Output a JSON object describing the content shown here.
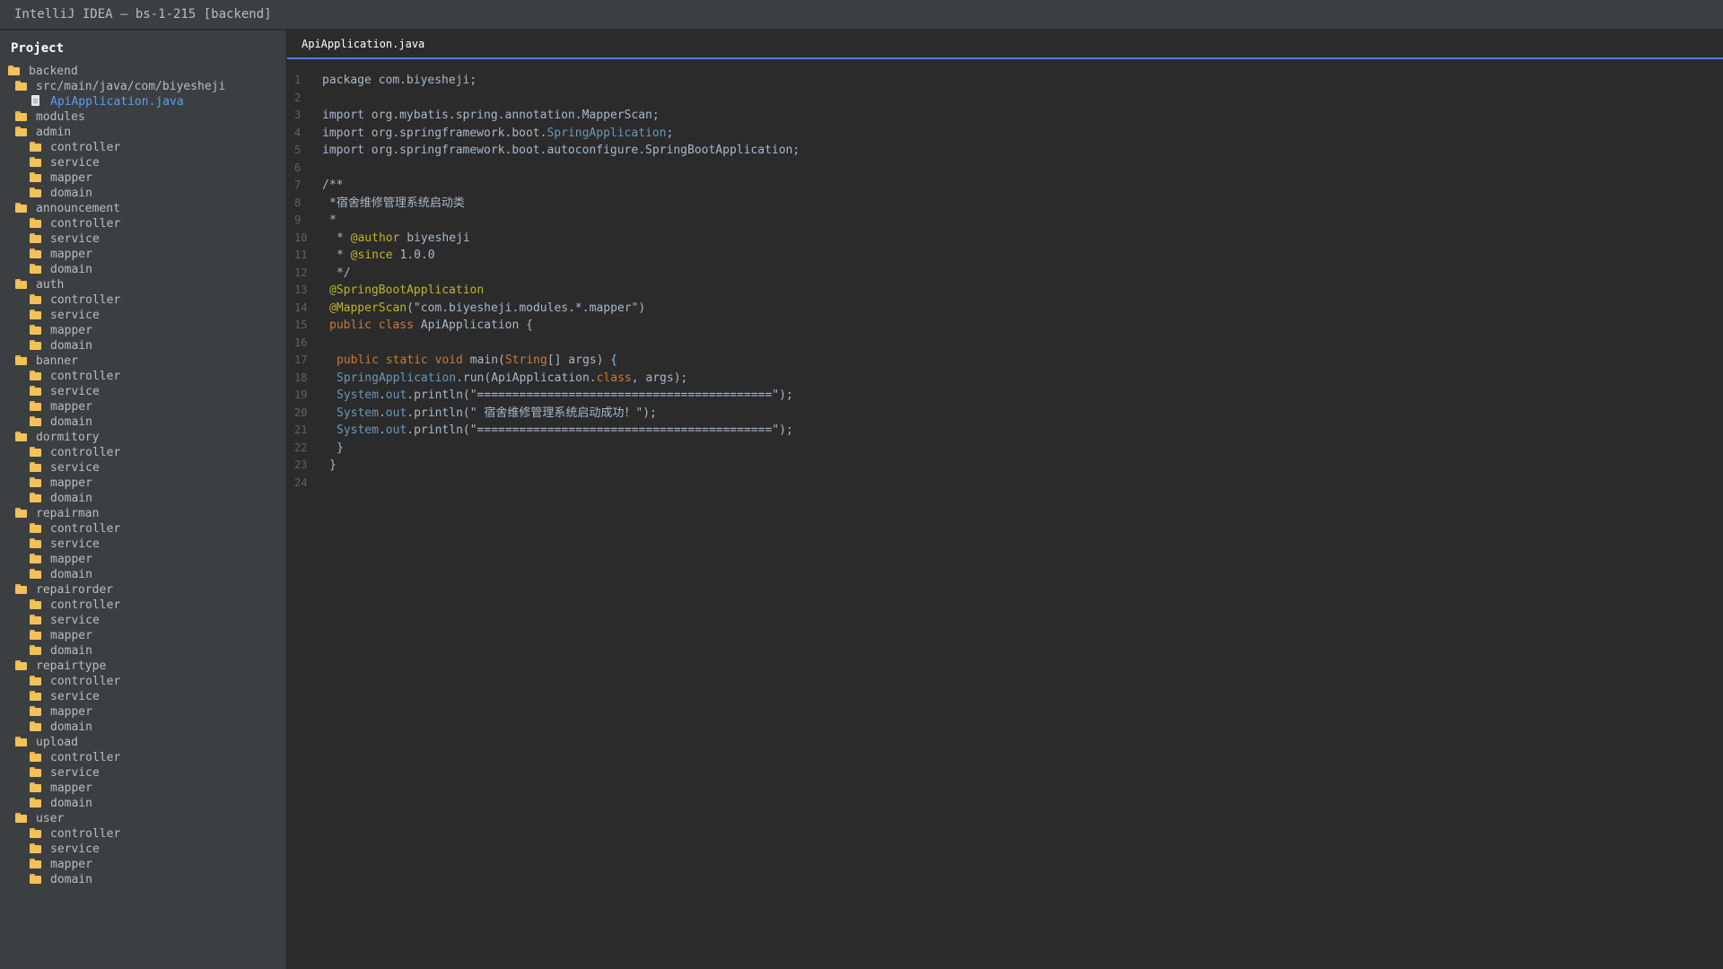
{
  "window": {
    "title": "IntelliJ IDEA — bs-1-215 [backend]"
  },
  "project_panel": {
    "title": "Project",
    "tree": [
      {
        "label": "backend",
        "type": "folder",
        "level": 0
      },
      {
        "label": "src/main/java/com/biyesheji",
        "type": "folder",
        "level": 1
      },
      {
        "label": "ApiApplication.java",
        "type": "file",
        "level": 2,
        "selected": true
      },
      {
        "label": "modules",
        "type": "folder",
        "level": 1
      },
      {
        "label": "admin",
        "type": "folder",
        "level": 1
      },
      {
        "label": "controller",
        "type": "folder",
        "level": 2
      },
      {
        "label": "service",
        "type": "folder",
        "level": 2
      },
      {
        "label": "mapper",
        "type": "folder",
        "level": 2
      },
      {
        "label": "domain",
        "type": "folder",
        "level": 2
      },
      {
        "label": "announcement",
        "type": "folder",
        "level": 1
      },
      {
        "label": "controller",
        "type": "folder",
        "level": 2
      },
      {
        "label": "service",
        "type": "folder",
        "level": 2
      },
      {
        "label": "mapper",
        "type": "folder",
        "level": 2
      },
      {
        "label": "domain",
        "type": "folder",
        "level": 2
      },
      {
        "label": "auth",
        "type": "folder",
        "level": 1
      },
      {
        "label": "controller",
        "type": "folder",
        "level": 2
      },
      {
        "label": "service",
        "type": "folder",
        "level": 2
      },
      {
        "label": "mapper",
        "type": "folder",
        "level": 2
      },
      {
        "label": "domain",
        "type": "folder",
        "level": 2
      },
      {
        "label": "banner",
        "type": "folder",
        "level": 1
      },
      {
        "label": "controller",
        "type": "folder",
        "level": 2
      },
      {
        "label": "service",
        "type": "folder",
        "level": 2
      },
      {
        "label": "mapper",
        "type": "folder",
        "level": 2
      },
      {
        "label": "domain",
        "type": "folder",
        "level": 2
      },
      {
        "label": "dormitory",
        "type": "folder",
        "level": 1
      },
      {
        "label": "controller",
        "type": "folder",
        "level": 2
      },
      {
        "label": "service",
        "type": "folder",
        "level": 2
      },
      {
        "label": "mapper",
        "type": "folder",
        "level": 2
      },
      {
        "label": "domain",
        "type": "folder",
        "level": 2
      },
      {
        "label": "repairman",
        "type": "folder",
        "level": 1
      },
      {
        "label": "controller",
        "type": "folder",
        "level": 2
      },
      {
        "label": "service",
        "type": "folder",
        "level": 2
      },
      {
        "label": "mapper",
        "type": "folder",
        "level": 2
      },
      {
        "label": "domain",
        "type": "folder",
        "level": 2
      },
      {
        "label": "repairorder",
        "type": "folder",
        "level": 1
      },
      {
        "label": "controller",
        "type": "folder",
        "level": 2
      },
      {
        "label": "service",
        "type": "folder",
        "level": 2
      },
      {
        "label": "mapper",
        "type": "folder",
        "level": 2
      },
      {
        "label": "domain",
        "type": "folder",
        "level": 2
      },
      {
        "label": "repairtype",
        "type": "folder",
        "level": 1
      },
      {
        "label": "controller",
        "type": "folder",
        "level": 2
      },
      {
        "label": "service",
        "type": "folder",
        "level": 2
      },
      {
        "label": "mapper",
        "type": "folder",
        "level": 2
      },
      {
        "label": "domain",
        "type": "folder",
        "level": 2
      },
      {
        "label": "upload",
        "type": "folder",
        "level": 1
      },
      {
        "label": "controller",
        "type": "folder",
        "level": 2
      },
      {
        "label": "service",
        "type": "folder",
        "level": 2
      },
      {
        "label": "mapper",
        "type": "folder",
        "level": 2
      },
      {
        "label": "domain",
        "type": "folder",
        "level": 2
      },
      {
        "label": "user",
        "type": "folder",
        "level": 1
      },
      {
        "label": "controller",
        "type": "folder",
        "level": 2
      },
      {
        "label": "service",
        "type": "folder",
        "level": 2
      },
      {
        "label": "mapper",
        "type": "folder",
        "level": 2
      },
      {
        "label": "domain",
        "type": "folder",
        "level": 2
      }
    ]
  },
  "editor": {
    "active_tab": "ApiApplication.java",
    "lines": [
      {
        "n": "1",
        "indent": 0,
        "segments": [
          {
            "t": "package com.biyesheji;",
            "c": "plain"
          }
        ]
      },
      {
        "n": "2",
        "indent": 0,
        "segments": []
      },
      {
        "n": "3",
        "indent": 0,
        "segments": [
          {
            "t": "import org.mybatis.spring.annotation.MapperScan;",
            "c": "plain"
          }
        ]
      },
      {
        "n": "4",
        "indent": 0,
        "segments": [
          {
            "t": "import org.springframework.boot.",
            "c": "plain"
          },
          {
            "t": "SpringApplication",
            "c": "cls"
          },
          {
            "t": ";",
            "c": "plain"
          }
        ]
      },
      {
        "n": "5",
        "indent": 0,
        "segments": [
          {
            "t": "import org.springframework.boot.autoconfigure.SpringBootApplication;",
            "c": "plain"
          }
        ]
      },
      {
        "n": "6",
        "indent": 0,
        "segments": []
      },
      {
        "n": "7",
        "indent": 0,
        "segments": [
          {
            "t": "/**",
            "c": "cmt"
          }
        ]
      },
      {
        "n": "8",
        "indent": 1,
        "segments": [
          {
            "t": "*宿舍维修管理系统启动类",
            "c": "cmt"
          }
        ]
      },
      {
        "n": "9",
        "indent": 1,
        "segments": [
          {
            "t": "*",
            "c": "cmt"
          }
        ]
      },
      {
        "n": "10",
        "indent": 2,
        "segments": [
          {
            "t": "* ",
            "c": "cmt"
          },
          {
            "t": "@author",
            "c": "doctag"
          },
          {
            "t": " biyesheji",
            "c": "cmt"
          }
        ]
      },
      {
        "n": "11",
        "indent": 2,
        "segments": [
          {
            "t": "* ",
            "c": "cmt"
          },
          {
            "t": "@since",
            "c": "doctag"
          },
          {
            "t": " 1.0.0",
            "c": "cmt"
          }
        ]
      },
      {
        "n": "12",
        "indent": 2,
        "segments": [
          {
            "t": "*/",
            "c": "cmt"
          }
        ]
      },
      {
        "n": "13",
        "indent": 1,
        "segments": [
          {
            "t": "@SpringBootApplication",
            "c": "ann"
          }
        ]
      },
      {
        "n": "14",
        "indent": 1,
        "segments": [
          {
            "t": "@MapperScan",
            "c": "ann"
          },
          {
            "t": "(\"com.biyesheji.modules.*.mapper\")",
            "c": "plain"
          }
        ]
      },
      {
        "n": "15",
        "indent": 1,
        "segments": [
          {
            "t": "public class",
            "c": "kw"
          },
          {
            "t": " ApiApplication {",
            "c": "plain"
          }
        ]
      },
      {
        "n": "16",
        "indent": 0,
        "segments": []
      },
      {
        "n": "17",
        "indent": 2,
        "segments": [
          {
            "t": "public static void",
            "c": "kw"
          },
          {
            "t": " main(",
            "c": "plain"
          },
          {
            "t": "String",
            "c": "kw"
          },
          {
            "t": "[] args) {",
            "c": "plain"
          }
        ]
      },
      {
        "n": "18",
        "indent": 2,
        "segments": [
          {
            "t": "SpringApplication",
            "c": "cls"
          },
          {
            "t": ".run(ApiApplication.",
            "c": "plain"
          },
          {
            "t": "class",
            "c": "kw"
          },
          {
            "t": ", args);",
            "c": "plain"
          }
        ]
      },
      {
        "n": "19",
        "indent": 2,
        "segments": [
          {
            "t": "System",
            "c": "cls"
          },
          {
            "t": ".",
            "c": "plain"
          },
          {
            "t": "out",
            "c": "cls"
          },
          {
            "t": ".println(\"==========================================\");",
            "c": "plain"
          }
        ]
      },
      {
        "n": "20",
        "indent": 2,
        "segments": [
          {
            "t": "System",
            "c": "cls"
          },
          {
            "t": ".",
            "c": "plain"
          },
          {
            "t": "out",
            "c": "cls"
          },
          {
            "t": ".println(\" 宿舍维修管理系统启动成功！\");",
            "c": "plain"
          }
        ]
      },
      {
        "n": "21",
        "indent": 2,
        "segments": [
          {
            "t": "System",
            "c": "cls"
          },
          {
            "t": ".",
            "c": "plain"
          },
          {
            "t": "out",
            "c": "cls"
          },
          {
            "t": ".println(\"==========================================\");",
            "c": "plain"
          }
        ]
      },
      {
        "n": "22",
        "indent": 2,
        "segments": [
          {
            "t": "}",
            "c": "plain"
          }
        ]
      },
      {
        "n": "23",
        "indent": 1,
        "segments": [
          {
            "t": "}",
            "c": "plain"
          }
        ]
      },
      {
        "n": "24",
        "indent": 0,
        "segments": []
      }
    ]
  },
  "colors": {
    "keyword": "#cc7832",
    "annotation": "#bbb529",
    "class_ref": "#6897bb",
    "plain": "#a9b7c6",
    "selected_file": "#589df6",
    "tab_underline": "#4a88c7"
  }
}
